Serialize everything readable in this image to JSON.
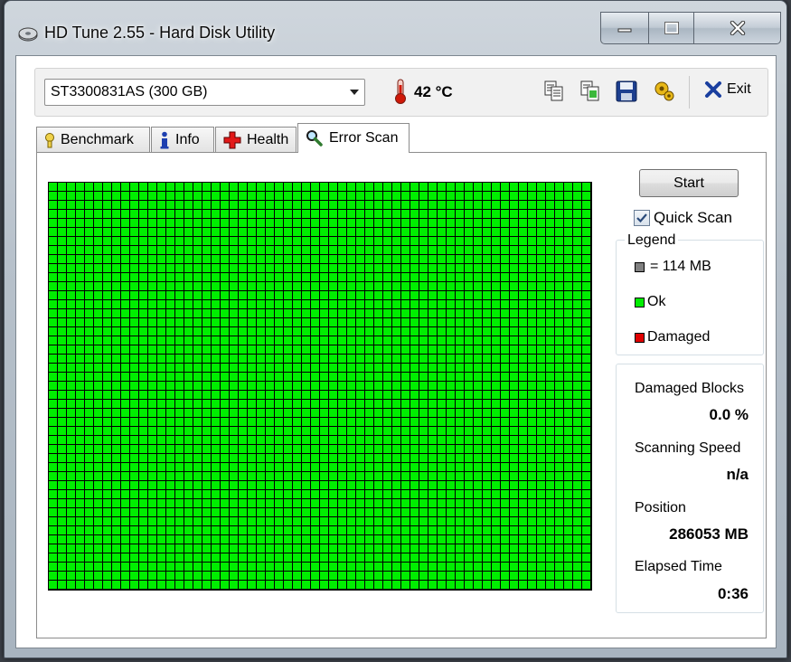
{
  "window": {
    "title": "HD Tune 2.55 - Hard Disk Utility"
  },
  "toolbar": {
    "drive_selected": "ST3300831AS (300 GB)",
    "temperature": "42 °C",
    "icons": [
      "copy-text-icon",
      "copy-screenshot-icon",
      "save-icon",
      "options-icon"
    ],
    "exit_label": "Exit"
  },
  "tabs": [
    {
      "label": "Benchmark",
      "icon": "benchmark-icon",
      "active": false
    },
    {
      "label": "Info",
      "icon": "info-icon",
      "active": false
    },
    {
      "label": "Health",
      "icon": "health-cross-icon",
      "active": false
    },
    {
      "label": "Error Scan",
      "icon": "magnifier-icon",
      "active": true
    }
  ],
  "scan": {
    "start_label": "Start",
    "quick_scan_label": "Quick Scan",
    "quick_scan_checked": true,
    "block_state": "Ok"
  },
  "legend": {
    "title": "Legend",
    "items": [
      {
        "label": "= 114 MB",
        "color": "#808080"
      },
      {
        "label": "Ok",
        "color": "#00ee00"
      },
      {
        "label": "Damaged",
        "color": "#e00000"
      }
    ]
  },
  "stats": {
    "damaged_blocks_label": "Damaged Blocks",
    "damaged_blocks_value": "0.0 %",
    "scanning_speed_label": "Scanning Speed",
    "scanning_speed_value": "n/a",
    "position_label": "Position",
    "position_value": "286053 MB",
    "elapsed_label": "Elapsed Time",
    "elapsed_value": "0:36"
  },
  "colors": {
    "ok_block": "#00ee00",
    "damaged_block": "#e00000",
    "unused_block": "#808080"
  }
}
